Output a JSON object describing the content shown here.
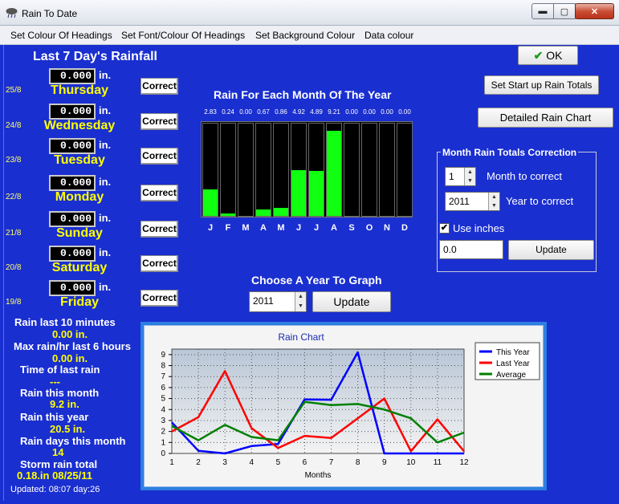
{
  "window": {
    "title": "Rain To Date",
    "min_glyph": "▬",
    "max_glyph": "▢",
    "close_glyph": "✕"
  },
  "menu": [
    "Set Colour Of Headings",
    "Set Font/Colour Of Headings",
    "Set Background Colour",
    "Data colour"
  ],
  "days": {
    "title": "Last 7 Day's Rainfall",
    "unit": "in.",
    "correct_label": "Correct",
    "items": [
      {
        "date": "25/8",
        "value": "0.000",
        "name": "Thursday"
      },
      {
        "date": "24/8",
        "value": "0.000",
        "name": "Wednesday"
      },
      {
        "date": "23/8",
        "value": "0.000",
        "name": "Tuesday"
      },
      {
        "date": "22/8",
        "value": "0.000",
        "name": "Monday"
      },
      {
        "date": "21/8",
        "value": "0.000",
        "name": "Sunday"
      },
      {
        "date": "20/8",
        "value": "0.000",
        "name": "Saturday"
      },
      {
        "date": "19/8",
        "value": "0.000",
        "name": "Friday"
      }
    ]
  },
  "buttons": {
    "ok": "OK",
    "ok_check_glyph": "✔",
    "startup_totals": "Set Start up Rain Totals",
    "detailed_chart": "Detailed Rain Chart"
  },
  "monthly": {
    "title": "Rain For Each Month Of The Year",
    "labels": [
      "J",
      "F",
      "M",
      "A",
      "M",
      "J",
      "J",
      "A",
      "S",
      "O",
      "N",
      "D"
    ],
    "value_labels": [
      "2.83",
      "0.24",
      "0.00",
      "0.67",
      "0.86",
      "4.92",
      "4.89",
      "9.21",
      "0.00",
      "0.00",
      "0.00",
      "0.00"
    ],
    "values": [
      2.83,
      0.24,
      0.0,
      0.67,
      0.86,
      4.92,
      4.89,
      9.21,
      0.0,
      0.0,
      0.0,
      0.0
    ],
    "max": 10,
    "bar_color": "#11ff11"
  },
  "correction": {
    "legend": "Month Rain Totals Correction",
    "month_value": "1",
    "month_label": "Month to correct",
    "year_value": "2011",
    "year_label": "Year to correct",
    "use_inches_label": "Use inches",
    "use_inches_checked": true,
    "check_glyph": "✔",
    "amount_value": "0.0",
    "update_label": "Update"
  },
  "graph_year": {
    "title": "Choose A Year To Graph",
    "year_value": "2011",
    "update_label": "Update"
  },
  "spin_arrows": {
    "up": "▲",
    "down": "▼"
  },
  "stats": [
    {
      "label": "Rain last 10 minutes",
      "value": "0.00 in."
    },
    {
      "label": "Max rain/hr last 6 hours",
      "value": "0.00 in."
    },
    {
      "label": "Time of last rain",
      "value": "---"
    },
    {
      "label": "Rain this month",
      "value": "9.2 in."
    },
    {
      "label": "Rain this year",
      "value": "20.5 in."
    },
    {
      "label": "Rain days this month",
      "value": "14"
    },
    {
      "label": "Storm rain total",
      "value": "0.18.in 08/25/11"
    }
  ],
  "updated": "Updated: 08:07 day:26",
  "chart_data": {
    "type": "line",
    "title": "Rain Chart",
    "xlabel": "Months",
    "ylabel": "",
    "x": [
      1,
      2,
      3,
      4,
      5,
      6,
      7,
      8,
      9,
      10,
      11,
      12
    ],
    "xlim": [
      1,
      12
    ],
    "ylim": [
      0,
      9.5
    ],
    "yticks": [
      0,
      1,
      2,
      3,
      4,
      5,
      6,
      7,
      8,
      9
    ],
    "grid": true,
    "legend_position": "top-right",
    "series": [
      {
        "name": "This Year",
        "color": "#0000ff",
        "values": [
          2.83,
          0.24,
          0.0,
          0.67,
          0.86,
          4.92,
          4.89,
          9.21,
          0.0,
          0.0,
          0.0,
          0.0
        ]
      },
      {
        "name": "Last Year",
        "color": "#ff0000",
        "values": [
          2.0,
          3.3,
          7.5,
          2.3,
          0.5,
          1.6,
          1.4,
          3.2,
          5.0,
          0.2,
          3.1,
          0.2
        ]
      },
      {
        "name": "Average",
        "color": "#008000",
        "values": [
          2.5,
          1.2,
          2.6,
          1.5,
          1.2,
          4.7,
          4.4,
          4.5,
          4.0,
          3.2,
          1.0,
          1.9
        ]
      }
    ]
  }
}
